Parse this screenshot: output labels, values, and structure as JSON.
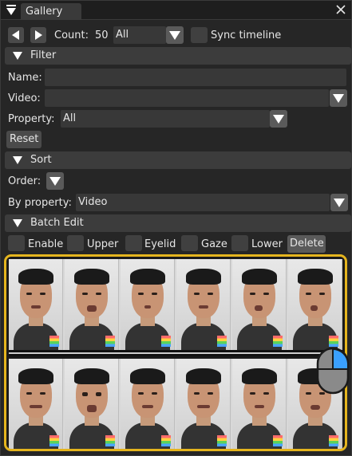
{
  "titlebar": {
    "tab_label": "Gallery"
  },
  "nav": {
    "count_label": "Count:",
    "count_value": "50",
    "count_filter": "All",
    "sync_label": "Sync timeline"
  },
  "filter": {
    "header": "Filter",
    "name_label": "Name:",
    "name_value": "",
    "video_label": "Video:",
    "video_value": "",
    "property_label": "Property:",
    "property_value": "All",
    "reset_label": "Reset"
  },
  "sort": {
    "header": "Sort",
    "order_label": "Order:",
    "by_property_label": "By property:",
    "by_property_value": "Video"
  },
  "batch": {
    "header": "Batch Edit",
    "items": [
      {
        "label": "Enable"
      },
      {
        "label": "Upper"
      },
      {
        "label": "Eyelid"
      },
      {
        "label": "Gaze"
      },
      {
        "label": "Lower"
      }
    ],
    "delete_label": "Delete"
  },
  "gallery": {
    "rows": [
      {
        "thumbs": [
          "",
          "",
          "",
          "",
          "",
          ""
        ]
      },
      {
        "thumbs": [
          "",
          "",
          "",
          "",
          "",
          ""
        ]
      }
    ]
  },
  "icons": {
    "menu": "menu-triangle-icon",
    "close": "close-icon",
    "mouse": "mouse-scroll-icon"
  },
  "colors": {
    "accent": "#e5b51e",
    "background": "#262626",
    "button": "#4a4a4a"
  }
}
